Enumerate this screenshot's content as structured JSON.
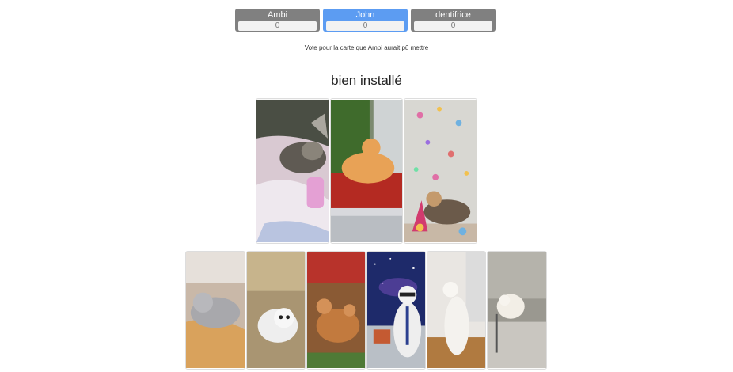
{
  "scoreboard": {
    "players": [
      {
        "name": "Ambi",
        "score": "0"
      },
      {
        "name": "John",
        "score": "0"
      },
      {
        "name": "dentifrice",
        "score": "0"
      }
    ]
  },
  "instruction": "Vote pour la carte que Ambi aurait pû mettre",
  "clue": "bien installé",
  "colors": {
    "active_player": "#5c9cf2",
    "inactive_player": "#808080"
  },
  "table_cards": [
    {
      "subject": "cat-sleeping-in-blanket-photo"
    },
    {
      "subject": "orange-cat-in-red-tray-photo"
    },
    {
      "subject": "cat-with-confetti-photo"
    }
  ],
  "hand_cards": [
    {
      "subject": "grey-kitten-sleeping-on-pillow-photo"
    },
    {
      "subject": "white-kitten-on-sofa-photo"
    },
    {
      "subject": "cat-lying-on-back-in-grass-photo"
    },
    {
      "subject": "cat-with-glasses-and-tie-in-space-photo"
    },
    {
      "subject": "white-cat-standing-photo"
    },
    {
      "subject": "fluffy-cat-on-carpet-photo"
    }
  ]
}
